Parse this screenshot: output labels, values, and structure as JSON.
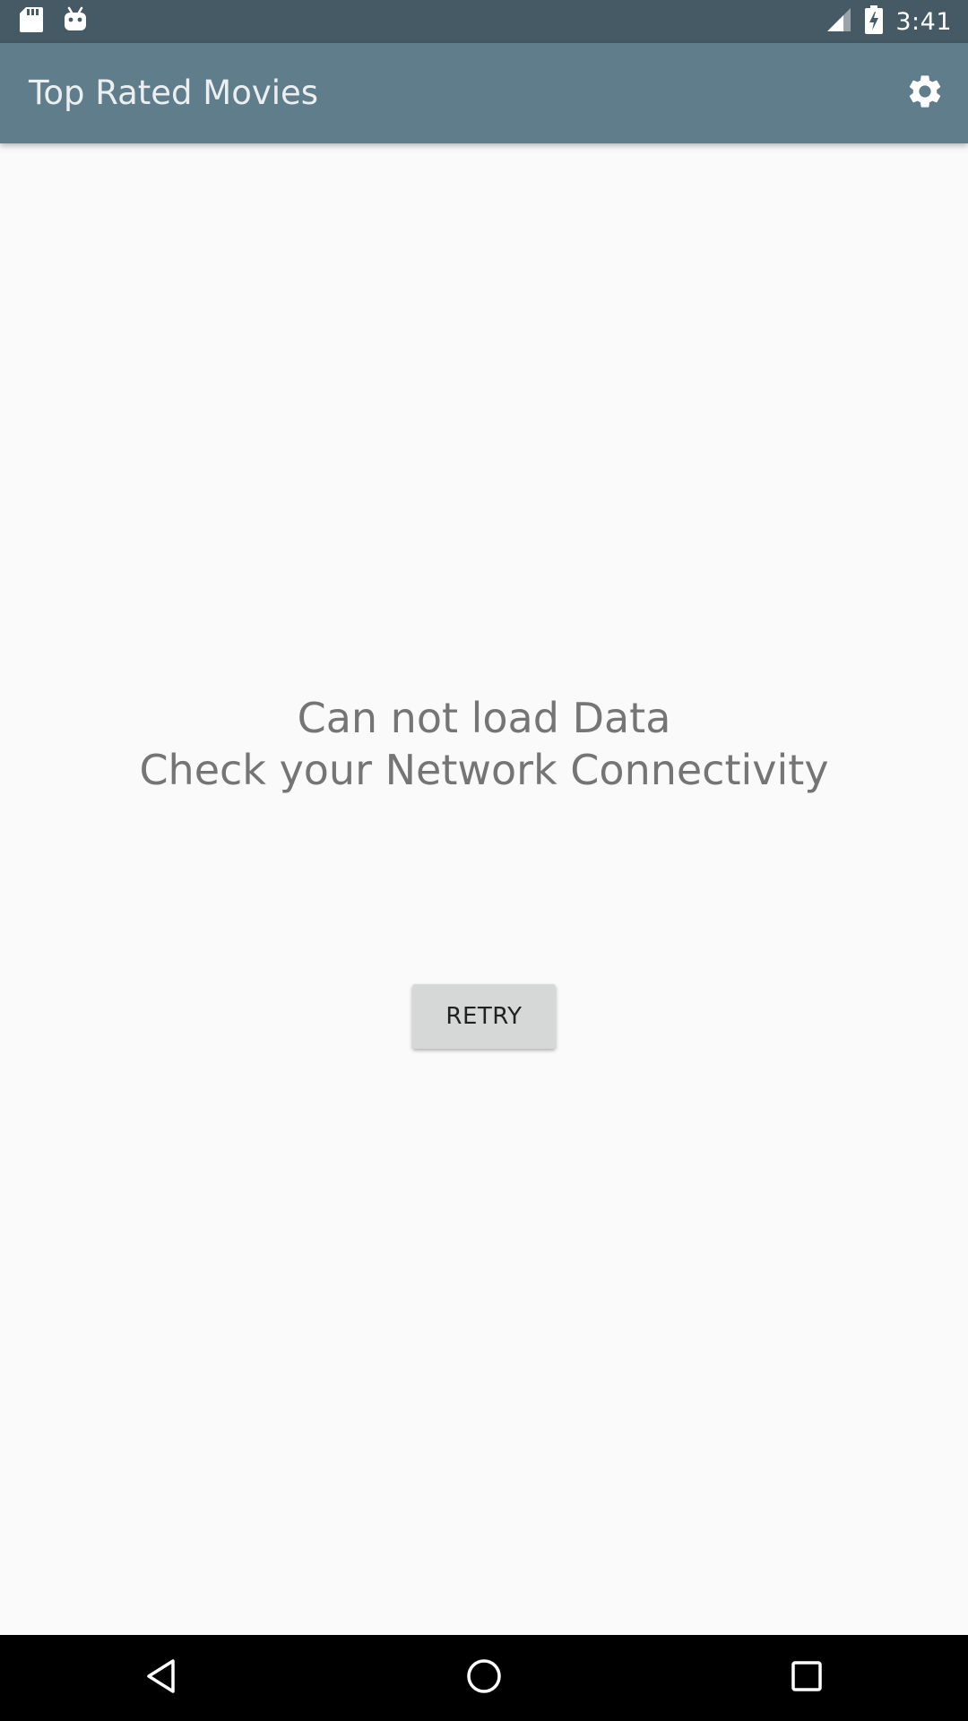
{
  "status_bar": {
    "time": "3:41",
    "left_icons": [
      "sd-card-icon",
      "android-debug-icon"
    ],
    "right_icons": [
      "signal-icon",
      "battery-charging-icon"
    ],
    "background": "#455a64"
  },
  "app_bar": {
    "title": "Top Rated Movies",
    "action_icon": "gear-icon",
    "background": "#607d8b"
  },
  "main": {
    "error_line_1": "Can not load Data",
    "error_line_2": "Check your Network Connectivity",
    "retry_label": "RETRY"
  },
  "nav_bar": {
    "buttons": [
      "back-icon",
      "home-icon",
      "recents-icon"
    ],
    "background": "#000000"
  }
}
